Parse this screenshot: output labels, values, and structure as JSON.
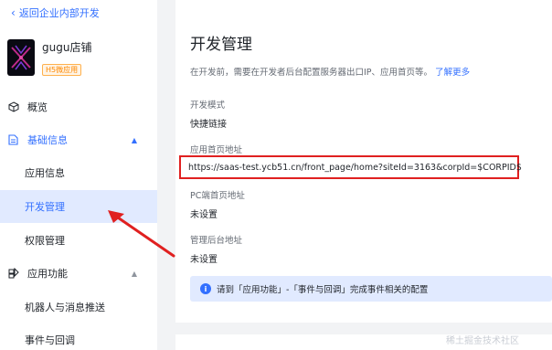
{
  "back_link": {
    "label": "返回企业内部开发"
  },
  "app": {
    "name": "gugu店铺",
    "badge": "H5微应用"
  },
  "nav": {
    "overview": "概览",
    "basic_info": "基础信息",
    "app_info": "应用信息",
    "dev_manage": "开发管理",
    "permission": "权限管理",
    "app_features": "应用功能",
    "robot_push": "机器人与消息推送",
    "events": "事件与回调"
  },
  "main": {
    "title": "开发管理",
    "desc": "在开发前，需要在开发者后台配置服务器出口IP、应用首页等。",
    "learn_more": "了解更多",
    "dev_mode_label": "开发模式",
    "dev_mode_value": "快捷链接",
    "home_url_label": "应用首页地址",
    "home_url_value": "https://saas-test.ycb51.cn/front_page/home?siteId=3163&corpId=$CORPID$",
    "pc_url_label": "PC端首页地址",
    "pc_url_value": "未设置",
    "admin_url_label": "管理后台地址",
    "admin_url_value": "未设置",
    "info": "请到「应用功能」-「事件与回调」完成事件相关的配置"
  },
  "watermark": "稀土掘金技术社区",
  "colors": {
    "accent": "#3370ff",
    "highlight": "#e02020",
    "selected_bg": "#e1eaff"
  }
}
